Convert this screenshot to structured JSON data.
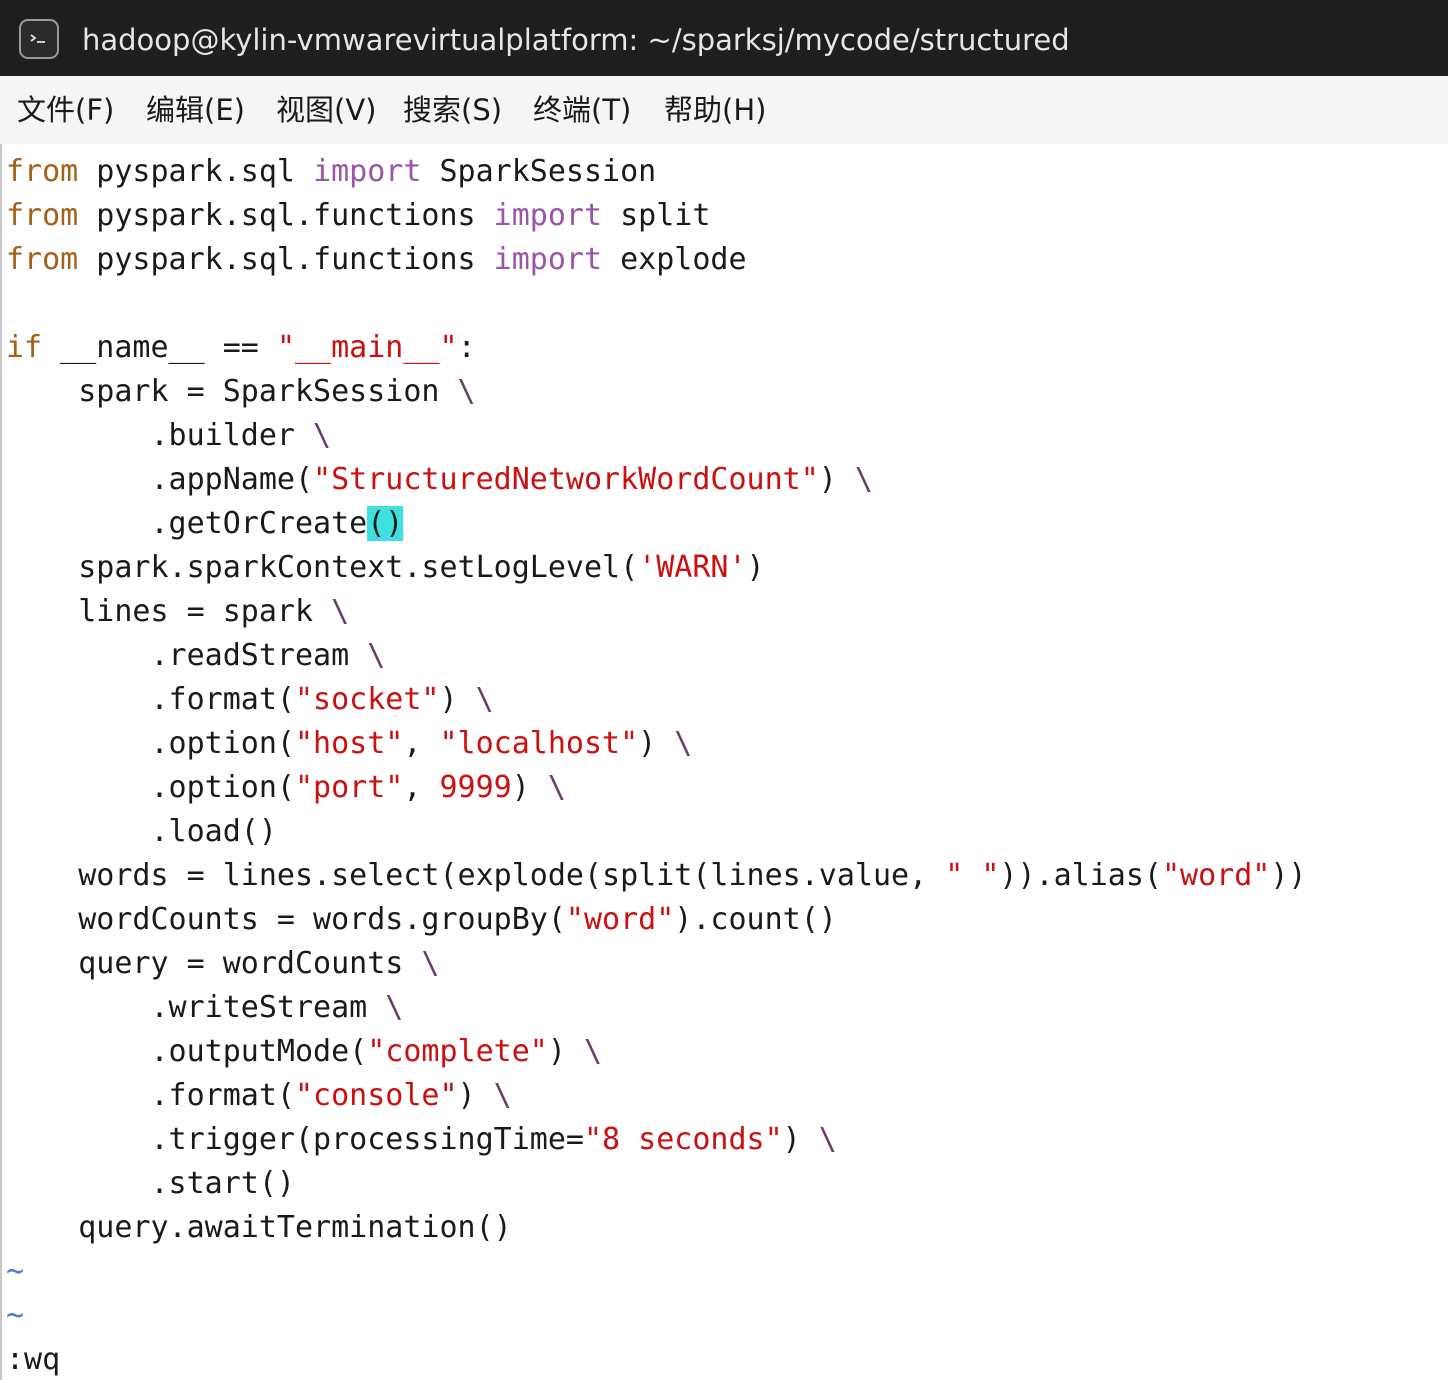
{
  "window": {
    "title": "hadoop@kylin-vmwarevirtualplatform: ~/sparksj/mycode/structured",
    "icon": "terminal-icon"
  },
  "menu": [
    {
      "label": "文件(F)"
    },
    {
      "label": "编辑(E)"
    },
    {
      "label": "视图(V)"
    },
    {
      "label": "搜索(S)"
    },
    {
      "label": "终端(T)"
    },
    {
      "label": "帮助(H)"
    }
  ],
  "editor": {
    "lines": [
      [
        {
          "t": "from",
          "c": "kw"
        },
        {
          "t": " pyspark.sql ",
          "c": ""
        },
        {
          "t": "import",
          "c": "imp"
        },
        {
          "t": " SparkSession",
          "c": ""
        }
      ],
      [
        {
          "t": "from",
          "c": "kw"
        },
        {
          "t": " pyspark.sql.functions ",
          "c": ""
        },
        {
          "t": "import",
          "c": "imp"
        },
        {
          "t": " split",
          "c": ""
        }
      ],
      [
        {
          "t": "from",
          "c": "kw"
        },
        {
          "t": " pyspark.sql.functions ",
          "c": ""
        },
        {
          "t": "import",
          "c": "imp"
        },
        {
          "t": " explode",
          "c": ""
        }
      ],
      [],
      [
        {
          "t": "if",
          "c": "kw"
        },
        {
          "t": " __name__ == ",
          "c": ""
        },
        {
          "t": "\"__main__\"",
          "c": "str"
        },
        {
          "t": ":",
          "c": ""
        }
      ],
      [
        {
          "t": "    spark = SparkSession ",
          "c": ""
        },
        {
          "t": "\\",
          "c": "bs"
        }
      ],
      [
        {
          "t": "        .builder ",
          "c": ""
        },
        {
          "t": "\\",
          "c": "bs"
        }
      ],
      [
        {
          "t": "        .appName(",
          "c": ""
        },
        {
          "t": "\"StructuredNetworkWordCount\"",
          "c": "str"
        },
        {
          "t": ") ",
          "c": ""
        },
        {
          "t": "\\",
          "c": "bs"
        }
      ],
      [
        {
          "t": "        .getOrCreate",
          "c": ""
        },
        {
          "t": "()",
          "c": "cursor-hl"
        }
      ],
      [
        {
          "t": "    spark.sparkContext.setLogLevel(",
          "c": ""
        },
        {
          "t": "'WARN'",
          "c": "str"
        },
        {
          "t": ")",
          "c": ""
        }
      ],
      [
        {
          "t": "    lines = spark ",
          "c": ""
        },
        {
          "t": "\\",
          "c": "bs"
        }
      ],
      [
        {
          "t": "        .readStream ",
          "c": ""
        },
        {
          "t": "\\",
          "c": "bs"
        }
      ],
      [
        {
          "t": "        .format(",
          "c": ""
        },
        {
          "t": "\"socket\"",
          "c": "str"
        },
        {
          "t": ") ",
          "c": ""
        },
        {
          "t": "\\",
          "c": "bs"
        }
      ],
      [
        {
          "t": "        .option(",
          "c": ""
        },
        {
          "t": "\"host\"",
          "c": "str"
        },
        {
          "t": ", ",
          "c": ""
        },
        {
          "t": "\"localhost\"",
          "c": "str"
        },
        {
          "t": ") ",
          "c": ""
        },
        {
          "t": "\\",
          "c": "bs"
        }
      ],
      [
        {
          "t": "        .option(",
          "c": ""
        },
        {
          "t": "\"port\"",
          "c": "str"
        },
        {
          "t": ", ",
          "c": ""
        },
        {
          "t": "9999",
          "c": "num"
        },
        {
          "t": ") ",
          "c": ""
        },
        {
          "t": "\\",
          "c": "bs"
        }
      ],
      [
        {
          "t": "        .load()",
          "c": ""
        }
      ],
      [
        {
          "t": "    words = lines.select(explode(split(lines.value, ",
          "c": ""
        },
        {
          "t": "\" \"",
          "c": "str"
        },
        {
          "t": ")).alias(",
          "c": ""
        },
        {
          "t": "\"word\"",
          "c": "str"
        },
        {
          "t": "))",
          "c": ""
        }
      ],
      [
        {
          "t": "    wordCounts = words.groupBy(",
          "c": ""
        },
        {
          "t": "\"word\"",
          "c": "str"
        },
        {
          "t": ").count()",
          "c": ""
        }
      ],
      [
        {
          "t": "    query = wordCounts ",
          "c": ""
        },
        {
          "t": "\\",
          "c": "bs"
        }
      ],
      [
        {
          "t": "        .writeStream ",
          "c": ""
        },
        {
          "t": "\\",
          "c": "bs"
        }
      ],
      [
        {
          "t": "        .outputMode(",
          "c": ""
        },
        {
          "t": "\"complete\"",
          "c": "str"
        },
        {
          "t": ") ",
          "c": ""
        },
        {
          "t": "\\",
          "c": "bs"
        }
      ],
      [
        {
          "t": "        .format(",
          "c": ""
        },
        {
          "t": "\"console\"",
          "c": "str"
        },
        {
          "t": ") ",
          "c": ""
        },
        {
          "t": "\\",
          "c": "bs"
        }
      ],
      [
        {
          "t": "        .trigger(processingTime=",
          "c": ""
        },
        {
          "t": "\"8 seconds\"",
          "c": "str"
        },
        {
          "t": ") ",
          "c": ""
        },
        {
          "t": "\\",
          "c": "bs"
        }
      ],
      [
        {
          "t": "        .start()",
          "c": ""
        }
      ],
      [
        {
          "t": "    query.awaitTermination()",
          "c": ""
        }
      ],
      [
        {
          "t": "~",
          "c": "tilde"
        }
      ],
      [
        {
          "t": "~",
          "c": "tilde"
        }
      ],
      [
        {
          "t": ":wq",
          "c": ""
        }
      ]
    ]
  },
  "colors": {
    "keyword": "#a56019",
    "import": "#9a54a8",
    "string": "#cc1010",
    "backslash": "#6a3d6a",
    "tilde": "#4a78d0",
    "cursor": "#3fe0e0"
  }
}
